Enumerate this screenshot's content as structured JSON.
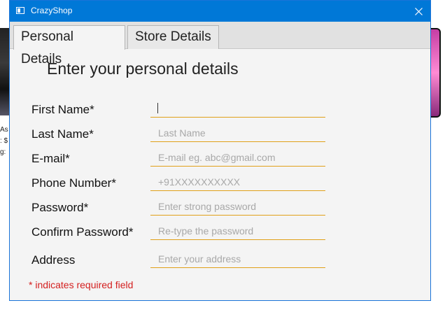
{
  "background": {
    "left_text": [
      "As",
      ": $",
      "g:"
    ]
  },
  "window": {
    "title": "CrazyShop"
  },
  "tabs": [
    {
      "label": "Personal Details",
      "active": true
    },
    {
      "label": "Store Details",
      "active": false
    }
  ],
  "form": {
    "heading": "Enter your personal details",
    "fields": [
      {
        "label": "First Name*",
        "value": "",
        "placeholder": "",
        "focused": true
      },
      {
        "label": "Last Name*",
        "value": "",
        "placeholder": "Last Name"
      },
      {
        "label": "E-mail*",
        "value": "",
        "placeholder": "E-mail eg. abc@gmail.com"
      },
      {
        "label": "Phone Number*",
        "value": "",
        "placeholder": "+91XXXXXXXXXX"
      },
      {
        "label": "Password*",
        "value": "",
        "placeholder": "Enter strong password"
      },
      {
        "label": "Confirm Password*",
        "value": "",
        "placeholder": "Re-type the password"
      },
      {
        "label": "Address",
        "value": "",
        "placeholder": "Enter your address"
      }
    ],
    "required_note": "* indicates required field"
  },
  "colors": {
    "titlebar": "#0078d7",
    "input_underline": "#e0a019",
    "required_note": "#d42020",
    "window_bg": "#f4f4f4"
  },
  "icons": {
    "app": "window-icon",
    "close": "close-icon"
  }
}
